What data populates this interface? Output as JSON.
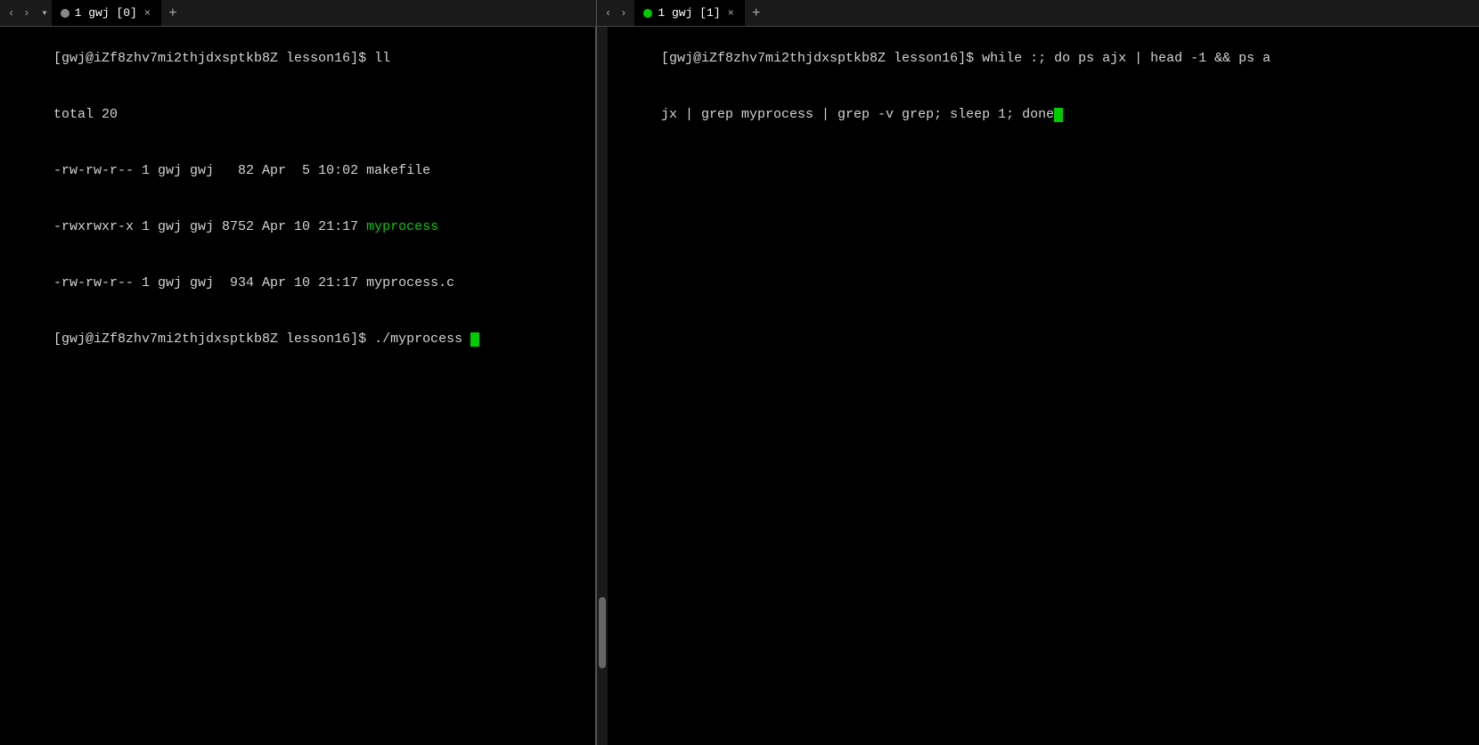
{
  "left_tab": {
    "indicator_color": "#888888",
    "label": "1 gwj [0]",
    "close": "×",
    "add": "+",
    "nav_left": "‹",
    "nav_right": "›",
    "dropdown": "▾"
  },
  "right_tab": {
    "indicator_color": "#00cc00",
    "label": "1 gwj [1]",
    "close": "×",
    "add": "+",
    "nav_left": "‹",
    "nav_right": "›"
  },
  "left_terminal": {
    "lines": [
      {
        "type": "prompt",
        "text": "[gwj@iZf8zhv7mi2thjdxsptkb8Z lesson16]$ ll"
      },
      {
        "type": "normal",
        "text": "total 20"
      },
      {
        "type": "normal",
        "text": "-rw-rw-r-- 1 gwj gwj   82 Apr  5 10:02 makefile"
      },
      {
        "type": "mixed",
        "prefix": "-rwxrwxr-x 1 gwj gwj 8752 Apr 10 21:17 ",
        "highlight": "myprocess",
        "suffix": ""
      },
      {
        "type": "normal",
        "text": "-rw-rw-r-- 1 gwj gwj  934 Apr 10 21:17 myprocess.c"
      },
      {
        "type": "prompt_cursor",
        "text": "[gwj@iZf8zhv7mi2thjdxsptkb8Z lesson16]$ ./myprocess "
      }
    ]
  },
  "right_terminal": {
    "lines": [
      {
        "type": "prompt_wrap",
        "text": "[gwj@iZf8zhv7mi2thjdxsptkb8Z lesson16]$ while :; do ps ajx | head -1 && ps ajx | grep myprocess | grep -v grep; sleep 1; done"
      }
    ]
  }
}
